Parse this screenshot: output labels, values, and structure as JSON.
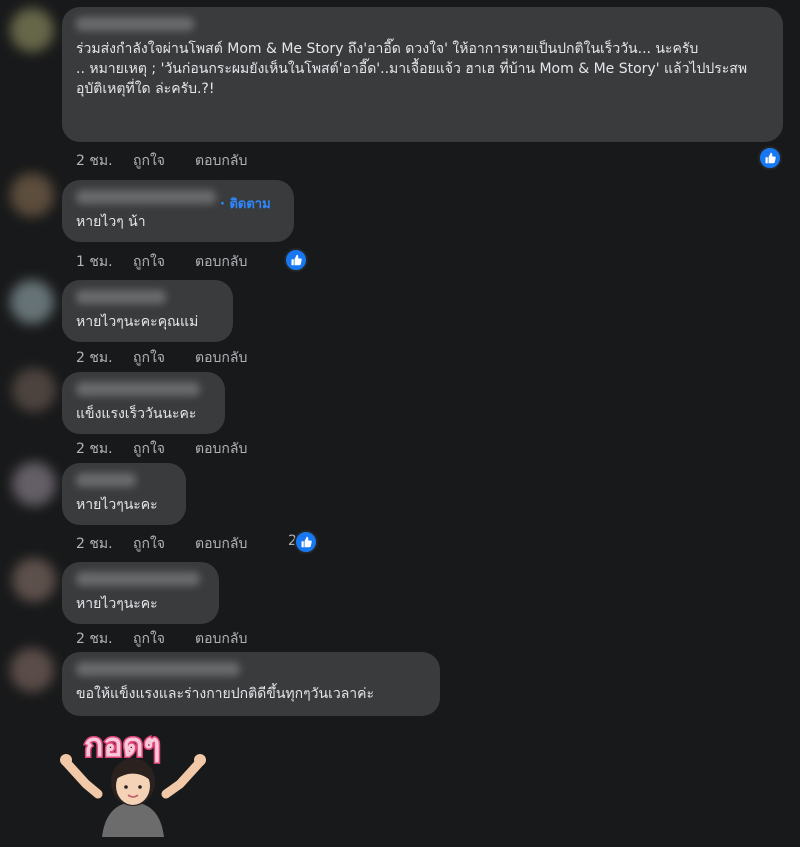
{
  "comments": [
    {
      "text": "ร่วมส่งกำลังใจผ่านโพสต์ Mom & Me Story ถึง'อาอี๊ด ดวงใจ' ให้อาการหายเป็นปกติในเร็ววัน... นะครับ\n.. หมายเหตุ ; 'วันก่อนกระผมยังเห็นในโพสต์'อาอี๊ด'..มาเจื้อยแจ้ว ฮาเฮ ที่บ้าน Mom & Me Story' แล้วไปประสพอุบัติเหตุที่ใด ล่ะครับ.?!",
      "time": "2 ชม.",
      "like": "ถูกใจ",
      "reply": "ตอบกลับ",
      "reaction_count": ""
    },
    {
      "follow": "· ติดตาม",
      "text": "หายไวๆ น้า",
      "time": "1 ชม.",
      "like": "ถูกใจ",
      "reply": "ตอบกลับ",
      "reaction_count": ""
    },
    {
      "text": "หายไวๆนะคะคุณแม่",
      "time": "2 ชม.",
      "like": "ถูกใจ",
      "reply": "ตอบกลับ"
    },
    {
      "text": "แข็งแรงเร็ววันนะคะ",
      "time": "2 ชม.",
      "like": "ถูกใจ",
      "reply": "ตอบกลับ"
    },
    {
      "text": "หายไวๆนะคะ",
      "time": "2 ชม.",
      "like": "ถูกใจ",
      "reply": "ตอบกลับ",
      "reaction_count": "2"
    },
    {
      "text": "หายไวๆนะคะ",
      "time": "2 ชม.",
      "like": "ถูกใจ",
      "reply": "ตอบกลับ"
    },
    {
      "text": "ขอให้แข็งแรงและร่างกายปกติดีขึ้นทุกๆวันเวลาค่ะ"
    }
  ],
  "sticker": {
    "text": "กอดๆ",
    "icon": "hug-sticker-icon"
  },
  "colors": {
    "background": "#18191a",
    "bubble": "#3a3b3c",
    "text": "#e4e6eb",
    "muted": "#b0b3b8",
    "accent": "#2d88ff",
    "like_badge": "#1877f2"
  }
}
